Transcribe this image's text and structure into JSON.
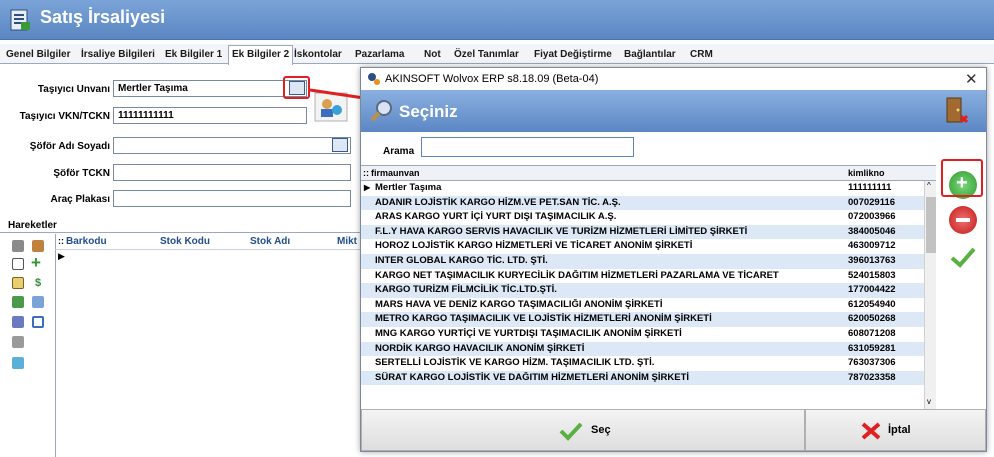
{
  "window": {
    "title": "Satış İrsaliyesi"
  },
  "tabs": [
    {
      "label": "Genel Bilgiler"
    },
    {
      "label": "İrsaliye Bilgileri"
    },
    {
      "label": "Ek Bilgiler 1"
    },
    {
      "label": "Ek Bilgiler 2"
    },
    {
      "label": "İskontolar"
    },
    {
      "label": "Pazarlama"
    },
    {
      "label": "Not"
    },
    {
      "label": "Özel Tanımlar"
    },
    {
      "label": "Fiyat Değiştirme"
    },
    {
      "label": "Bağlantılar"
    },
    {
      "label": "CRM"
    }
  ],
  "form": {
    "tasiyici_unvani": {
      "label": "Taşıyıcı Unvanı",
      "value": "Mertler Taşıma"
    },
    "tasiyici_vkn": {
      "label": "Taşıyıcı VKN/TCKN",
      "value": "11111111111"
    },
    "sofor_adi": {
      "label": "Şöför Adı Soyadı",
      "value": ""
    },
    "sofor_tckn": {
      "label": "Şöför TCKN",
      "value": ""
    },
    "arac_plakasi": {
      "label": "Araç Plakası",
      "value": ""
    }
  },
  "hareketler": {
    "title": "Hareketler",
    "columns": [
      "Barkodu",
      "Stok Kodu",
      "Stok Adı",
      "Mikt"
    ]
  },
  "dialog": {
    "app_title": "AKINSOFT Wolvox ERP s8.18.09 (Beta-04)",
    "header": "Seçiniz",
    "search_label": "Arama",
    "search_value": "",
    "columns": [
      "firmaunvan",
      "kimlikno"
    ],
    "rows": [
      {
        "firmaunvan": "Mertler Taşıma",
        "kimlikno": "111111111"
      },
      {
        "firmaunvan": "ADANIR LOJİSTİK KARGO HİZM.VE PET.SAN TİC. A.Ş.",
        "kimlikno": "007029116"
      },
      {
        "firmaunvan": "ARAS KARGO YURT İÇİ YURT DIŞI TAŞIMACILIK A.Ş.",
        "kimlikno": "072003966"
      },
      {
        "firmaunvan": "F.L.Y HAVA KARGO SERVIS HAVACILIK VE TURİZM HİZMETLERİ LİMİTED ŞİRKETİ",
        "kimlikno": "384005046"
      },
      {
        "firmaunvan": "HOROZ LOJİSTİK KARGO HİZMETLERİ VE TİCARET ANONİM ŞİRKETİ",
        "kimlikno": "463009712"
      },
      {
        "firmaunvan": "INTER GLOBAL KARGO TİC. LTD. ŞTİ.",
        "kimlikno": "396013763"
      },
      {
        "firmaunvan": "KARGO NET TAŞIMACILIK KURYECİLİK DAĞITIM HİZMETLERİ PAZARLAMA VE TİCARET",
        "kimlikno": "524015803"
      },
      {
        "firmaunvan": "KARGO TURİZM FİLMCİLİK TİC.LTD.ŞTİ.",
        "kimlikno": "177004422"
      },
      {
        "firmaunvan": "MARS HAVA VE DENİZ KARGO TAŞIMACILIĞI ANONİM ŞİRKETİ",
        "kimlikno": "612054940"
      },
      {
        "firmaunvan": "METRO KARGO TAŞIMACILIK VE LOJİSTİK HİZMETLERİ ANONİM ŞİRKETİ",
        "kimlikno": "620050268"
      },
      {
        "firmaunvan": "MNG KARGO YURTİÇİ VE YURTDIŞI TAŞIMACILIK ANONİM ŞİRKETİ",
        "kimlikno": "608071208"
      },
      {
        "firmaunvan": "NORDİK KARGO HAVACILIK ANONİM ŞİRKETİ",
        "kimlikno": "631059281"
      },
      {
        "firmaunvan": "SERTELLİ LOJİSTİK VE KARGO HİZM. TAŞIMACILIK LTD. ŞTİ.",
        "kimlikno": "763037306"
      },
      {
        "firmaunvan": "SÜRAT KARGO LOJİSTİK VE DAĞITIM HİZMETLERİ ANONİM ŞİRKETİ",
        "kimlikno": "787023358"
      }
    ],
    "select_label": "Seç",
    "cancel_label": "İptal"
  },
  "colors": {
    "accent": "#5b86c2",
    "highlight": "#e02020",
    "row_alt": "#dce8f6"
  }
}
